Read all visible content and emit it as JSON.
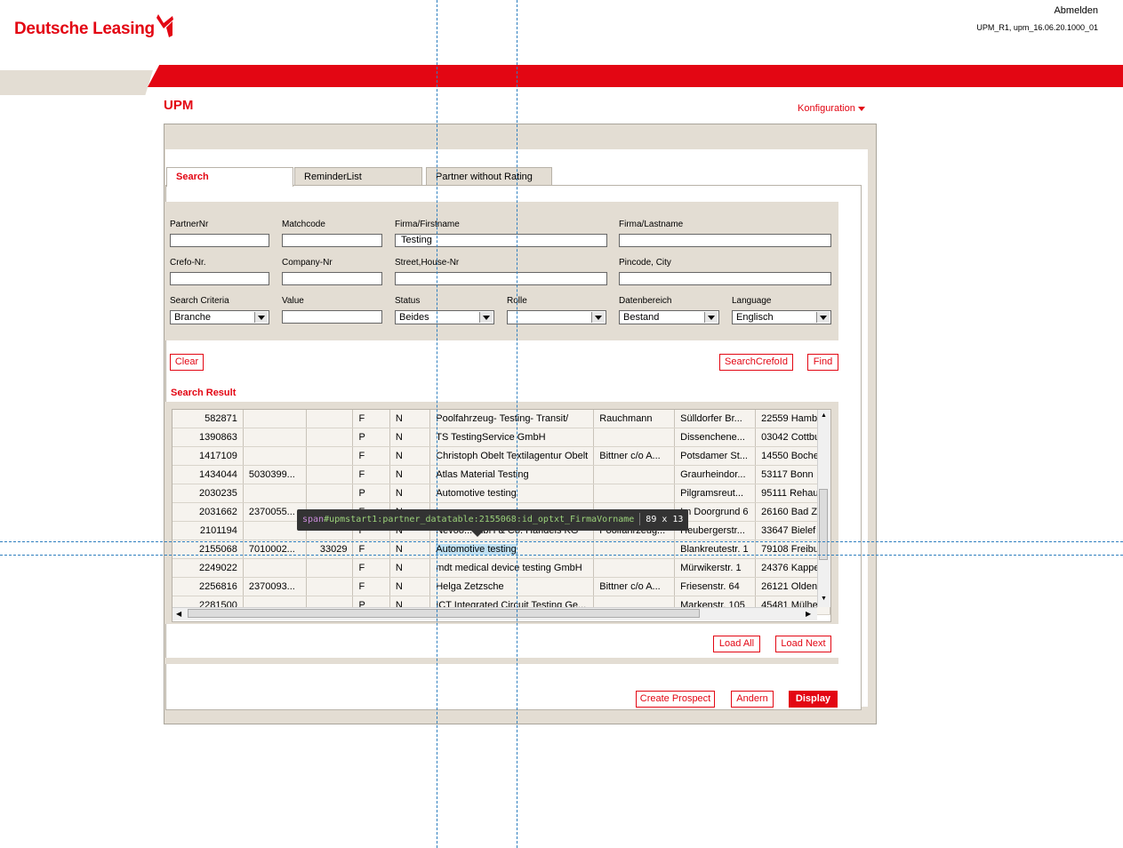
{
  "header": {
    "brand": "Deutsche Leasing",
    "logout": "Abmelden",
    "version": "UPM_R1, upm_16.06.20.1000_01",
    "app_title": "UPM",
    "config_menu": "Konfiguration",
    "brand_color": "#e30613"
  },
  "tabs": [
    {
      "label": "Search"
    },
    {
      "label": "ReminderList"
    },
    {
      "label": "Partner without Rating"
    }
  ],
  "form": {
    "partner_nr": {
      "label": "PartnerNr",
      "value": ""
    },
    "matchcode": {
      "label": "Matchcode",
      "value": ""
    },
    "firstname": {
      "label": "Firma/Firstname",
      "value": "Testing"
    },
    "lastname": {
      "label": "Firma/Lastname",
      "value": ""
    },
    "crefo": {
      "label": "Crefo-Nr.",
      "value": ""
    },
    "company_nr": {
      "label": "Company-Nr",
      "value": ""
    },
    "street": {
      "label": "Street,House-Nr",
      "value": ""
    },
    "pincode": {
      "label": "Pincode, City",
      "value": ""
    },
    "search_criteria": {
      "label": "Search Criteria",
      "value": "Branche"
    },
    "value": {
      "label": "Value",
      "value": ""
    },
    "status": {
      "label": "Status",
      "value": "Beides"
    },
    "rolle": {
      "label": "Rolle",
      "value": ""
    },
    "datenbereich": {
      "label": "Datenbereich",
      "value": "Bestand"
    },
    "language": {
      "label": "Language",
      "value": "Englisch"
    }
  },
  "buttons": {
    "clear": "Clear",
    "search_crefo": "SearchCrefoId",
    "find": "Find",
    "load_all": "Load All",
    "load_next": "Load Next",
    "create_prospect": "Create Prospect",
    "andern": "Andern",
    "display": "Display"
  },
  "search_result_label": "Search Result",
  "results": [
    [
      "582871",
      "",
      "",
      "F",
      "N",
      "Poolfahrzeug- Testing- Transit/",
      "Rauchmann",
      "Sülldorfer Br...",
      "22559 Hamb"
    ],
    [
      "1390863",
      "",
      "",
      "P",
      "N",
      "TS TestingService GmbH",
      "",
      "Dissenchene...",
      "03042 Cottbu"
    ],
    [
      "1417109",
      "",
      "",
      "F",
      "N",
      "Christoph Obelt Textilagentur Obelt",
      "Bittner c/o A...",
      "Potsdamer St...",
      "14550 Boche"
    ],
    [
      "1434044",
      "5030399...",
      "",
      "F",
      "N",
      "Atlas Material Testing",
      "",
      "Graurheindor...",
      "53117 Bonn"
    ],
    [
      "2030235",
      "",
      "",
      "P",
      "N",
      "Automotive testing",
      "",
      "Pilgramsreut...",
      "95111 Rehau"
    ],
    [
      "2031662",
      "2370055...",
      "",
      "F",
      "N",
      "",
      "",
      "Im Doorgrund 6",
      "26160 Bad Z"
    ],
    [
      "2101194",
      "",
      "",
      "F",
      "N",
      "Nevoo... mbH & Co. Handels KG",
      "Poolfahrzeug...",
      "Heubergerstr...",
      "33647 Bielef"
    ],
    [
      "2155068",
      "7010002...",
      "33029",
      "F",
      "N",
      "Automotive testing",
      "",
      "Blankreutestr. 1",
      "79108 Freibu"
    ],
    [
      "2249022",
      "",
      "",
      "F",
      "N",
      "mdt medical device testing GmbH",
      "",
      "Mürwikerstr. 1",
      "24376 Kappe"
    ],
    [
      "2256816",
      "2370093...",
      "",
      "F",
      "N",
      "Helga Zetzsche",
      "Bittner c/o A...",
      "Friesenstr. 64",
      "26121 Olden"
    ],
    [
      "2281500",
      "",
      "",
      "P",
      "N",
      "ICT Integrated Circuit Testing Ge...",
      "",
      "Markenstr. 105",
      "45481 Mülhe"
    ]
  ],
  "inspector": {
    "tag": "span",
    "selector": "#upmstart1:partner_datatable:2155068:id_optxt_FirmaVorname",
    "size": "89 x 13"
  }
}
